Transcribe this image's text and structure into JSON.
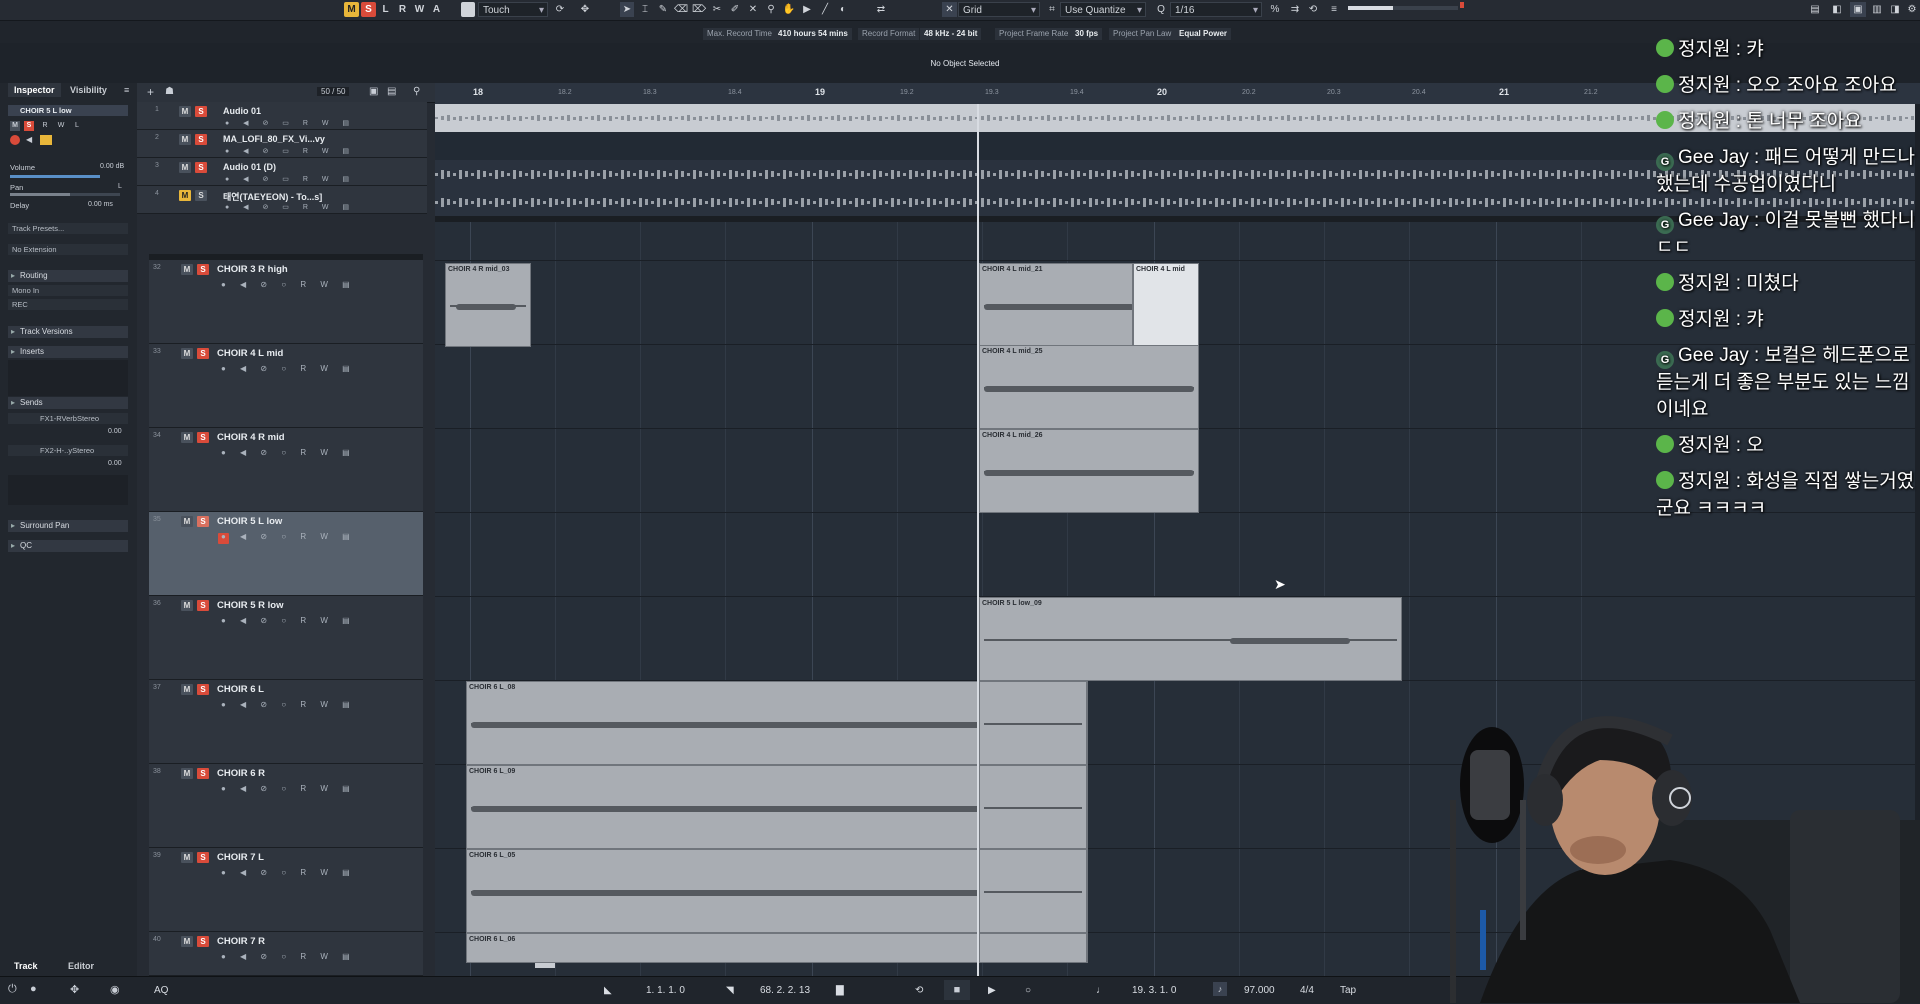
{
  "toolbar": {
    "m_label": "M",
    "s_label": "S",
    "l_label": "L",
    "r_label": "R",
    "w_label": "W",
    "a_label": "A",
    "automation_mode": "Touch",
    "snap_type": "Grid",
    "quantize_mode": "Use Quantize",
    "quantize_value": "1/16"
  },
  "status_line": {
    "max_record_time_label": "Max. Record Time",
    "max_record_time_value": "410 hours 54 mins",
    "record_format_label": "Record Format",
    "record_format_value": "48 kHz - 24 bit",
    "frame_rate_label": "Project Frame Rate",
    "frame_rate_value": "30 fps",
    "pan_law_label": "Project Pan Law",
    "pan_law_value": "Equal Power"
  },
  "info_line": "No Object Selected",
  "inspector": {
    "tab_inspector": "Inspector",
    "tab_visibility": "Visibility",
    "track_name": "CHOIR 5 L low",
    "volume_label": "Volume",
    "volume_value": "0.00 dB",
    "pan_label": "Pan",
    "pan_value": "L",
    "delay_label": "Delay",
    "delay_value": "0.00 ms",
    "track_presets": "Track Presets...",
    "extension": "No Extension",
    "routing": "Routing",
    "input": "Mono In",
    "output": "REC",
    "track_versions": "Track Versions",
    "inserts": "Inserts",
    "sends": "Sends",
    "send1": "FX1-RVerbStereo",
    "send1_value": "0.00",
    "send2": "FX2-H-..yStereo",
    "send2_value": "0.00",
    "surround_pan": "Surround Pan",
    "qc": "QC",
    "bottom_tab_track": "Track",
    "bottom_tab_editor": "Editor"
  },
  "tracklist": {
    "counter": "50 / 50",
    "top_tracks": [
      {
        "num": "1",
        "name": "Audio 01"
      },
      {
        "num": "2",
        "name": "MA_LOFI_80_FX_Vi...vy"
      },
      {
        "num": "3",
        "name": "Audio 01 (D)"
      },
      {
        "num": "4",
        "name": "태연(TAEYEON) - To...s]"
      }
    ],
    "tracks": [
      {
        "num": "32",
        "name": "CHOIR 3 R high"
      },
      {
        "num": "33",
        "name": "CHOIR 4 L mid"
      },
      {
        "num": "34",
        "name": "CHOIR 4 R mid"
      },
      {
        "num": "35",
        "name": "CHOIR 5 L low"
      },
      {
        "num": "36",
        "name": "CHOIR 5 R low"
      },
      {
        "num": "37",
        "name": "CHOIR 6 L"
      },
      {
        "num": "38",
        "name": "CHOIR 6 R"
      },
      {
        "num": "39",
        "name": "CHOIR 7 L"
      },
      {
        "num": "40",
        "name": "CHOIR 7 R"
      }
    ]
  },
  "ruler": {
    "bars": [
      "18",
      "19",
      "20",
      "21"
    ],
    "beats": [
      "18.2",
      "18.3",
      "18.4",
      "19.2",
      "19.3",
      "19.4",
      "20.2",
      "20.3",
      "20.4",
      "21.2"
    ]
  },
  "clips": [
    {
      "label": "CHOIR 4 R mid_03"
    },
    {
      "label": "CHOIR 4 L mid_21"
    },
    {
      "label": "CHOIR 4 L mid"
    },
    {
      "label": "CHOIR 4 L mid_25"
    },
    {
      "label": "CHOIR 4 L mid_26"
    },
    {
      "label": "CHOIR 5 L low_09"
    },
    {
      "label": "CHOIR 6 L_08"
    },
    {
      "label": "CHOIR 6 L_09"
    },
    {
      "label": "CHOIR 6 L_05"
    },
    {
      "label": "CHOIR 6 L_06"
    }
  ],
  "transport": {
    "left_locator": "1. 1. 1.   0",
    "right_locator": "68. 2. 2. 13",
    "position": "19. 3. 1.   0",
    "tempo": "97.000",
    "signature": "4/4",
    "tap": "Tap",
    "aq": "AQ"
  },
  "chat": [
    {
      "icon": "",
      "user": "정지원",
      "text": " : 캬"
    },
    {
      "icon": "",
      "user": "정지원",
      "text": " : 오오 조아요 조아요"
    },
    {
      "icon": "",
      "user": "정지원",
      "text": " : 톤 너무 조아요"
    },
    {
      "icon": "G",
      "user": "Gee Jay",
      "text": " : 패드 어떻게 만드나 했는데 수공업이였다니"
    },
    {
      "icon": "G",
      "user": "Gee Jay",
      "text": " : 이걸 못볼뻔 했다니 ㄷㄷ"
    },
    {
      "icon": "",
      "user": "정지원",
      "text": " : 미쳤다"
    },
    {
      "icon": "",
      "user": "정지원",
      "text": " : 캬"
    },
    {
      "icon": "G",
      "user": "Gee Jay",
      "text": " : 보컬은 헤드폰으로 듣는게 더 좋은 부분도 있는 느낌이네요"
    },
    {
      "icon": "",
      "user": "정지원",
      "text": " : 오"
    },
    {
      "icon": "",
      "user": "정지원",
      "text": " : 화성을 직접 쌓는거였군요 ㅋㅋㅋㅋ"
    }
  ],
  "colors": {
    "mute": "#e8b63a",
    "solo": "#d94b3a",
    "chat_icon": "#5bb54a"
  }
}
